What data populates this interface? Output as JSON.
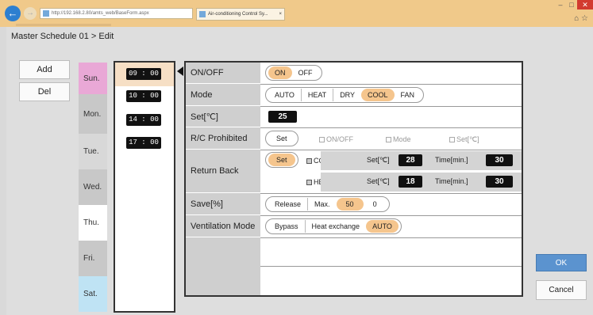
{
  "browser": {
    "address": "http://192.168.2.80/amts_web/BaseForm.aspx",
    "address_controls": "ρ ▾ C",
    "tab_title": "Air-conditioning Control Sy...",
    "tab_close": "×",
    "win_min": "–",
    "win_max": "□",
    "win_close": "✕",
    "right_icons": "⌂ ☆"
  },
  "page": {
    "title": "Master Schedule 01 > Edit"
  },
  "side": {
    "add_label": "Add",
    "del_label": "Del"
  },
  "days": [
    "Sun.",
    "Mon.",
    "Tue.",
    "Wed.",
    "Thu.",
    "Fri.",
    "Sat."
  ],
  "times": [
    "09 : 00",
    "10 : 00",
    "14 : 00",
    "17 : 00"
  ],
  "settings": {
    "onoff": {
      "label": "ON/OFF",
      "options": [
        "ON",
        "OFF"
      ],
      "selected": "ON"
    },
    "mode": {
      "label": "Mode",
      "options": [
        "AUTO",
        "HEAT",
        "DRY",
        "COOL",
        "FAN"
      ],
      "selected": "COOL"
    },
    "set_temp": {
      "label": "Set[℃]",
      "value": "25"
    },
    "rc_prohibited": {
      "label": "R/C Prohibited",
      "set_label": "Set",
      "options": [
        "ON/OFF",
        "Mode",
        "Set[℃]"
      ]
    },
    "return_back": {
      "label": "Return Back",
      "set_label": "Set",
      "cool": {
        "label": "COOL",
        "set_label": "Set[℃]",
        "set_value": "28",
        "time_label": "Time[min.]",
        "time_value": "30"
      },
      "heat": {
        "label": "HEAT",
        "set_label": "Set[℃]",
        "set_value": "18",
        "time_label": "Time[min.]",
        "time_value": "30"
      }
    },
    "save": {
      "label": "Save[%]",
      "options": [
        "Release",
        "Max.",
        "50",
        "0"
      ],
      "selected": "50"
    },
    "ventilation": {
      "label": "Ventilation Mode",
      "options": [
        "Bypass",
        "Heat exchange",
        "AUTO"
      ],
      "selected": "AUTO"
    }
  },
  "footer": {
    "ok_label": "OK",
    "cancel_label": "Cancel"
  },
  "colors": {
    "accent_orange": "#f5c58d",
    "ok_blue": "#5b93cf",
    "sunday_pink": "#e9a8d6",
    "saturday_blue": "#bfe3f4"
  }
}
